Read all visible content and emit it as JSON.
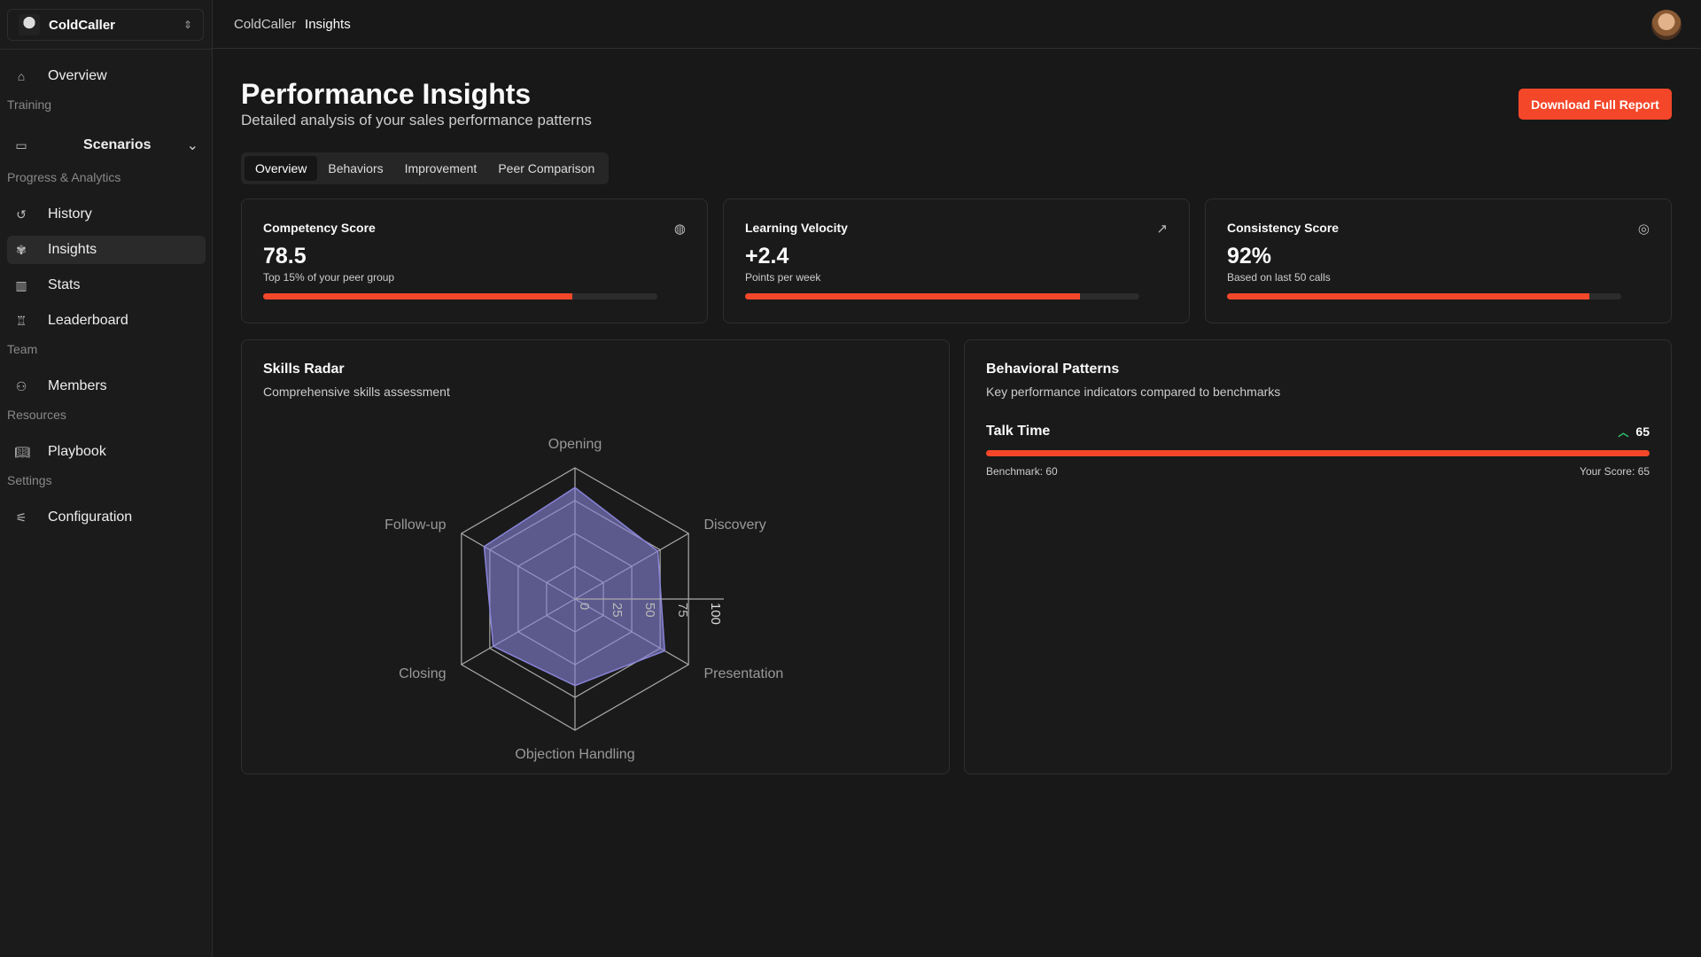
{
  "app": {
    "name": "ColdCaller"
  },
  "breadcrumb": [
    "ColdCaller",
    "Insights"
  ],
  "sidebar": {
    "overview": "Overview",
    "sections": {
      "training": "Training",
      "progress": "Progress & Analytics",
      "team": "Team",
      "resources": "Resources",
      "settings": "Settings"
    },
    "scenarios": "Scenarios",
    "history": "History",
    "insights": "Insights",
    "stats": "Stats",
    "leaderboard": "Leaderboard",
    "members": "Members",
    "playbook": "Playbook",
    "configuration": "Configuration"
  },
  "page": {
    "title": "Performance Insights",
    "subtitle": "Detailed analysis of your sales performance patterns",
    "download": "Download Full Report"
  },
  "tabs": [
    "Overview",
    "Behaviors",
    "Improvement",
    "Peer Comparison"
  ],
  "kpis": [
    {
      "title": "Competency Score",
      "value": "78.5",
      "sub": "Top 15% of your peer group",
      "progress": 78.5,
      "icon": "brain-icon"
    },
    {
      "title": "Learning Velocity",
      "value": "+2.4",
      "sub": "Points per week",
      "progress": 85,
      "icon": "trending-up-icon"
    },
    {
      "title": "Consistency Score",
      "value": "92%",
      "sub": "Based on last 50 calls",
      "progress": 92,
      "icon": "target-icon"
    }
  ],
  "radar": {
    "title": "Skills Radar",
    "subtitle": "Comprehensive skills assessment"
  },
  "behavior": {
    "title": "Behavioral Patterns",
    "subtitle": "Key performance indicators compared to benchmarks",
    "items": [
      {
        "name": "Talk Time",
        "score": "65",
        "benchmark": "Benchmark: 60",
        "your_score": "Your Score: 65",
        "progress": 100
      }
    ]
  },
  "colors": {
    "accent": "#f4472a",
    "radar_fill": "#8884d8",
    "up": "#2ecc71"
  },
  "chart_data": {
    "type": "radar",
    "categories": [
      "Opening",
      "Discovery",
      "Presentation",
      "Objection Handling",
      "Closing",
      "Follow-up"
    ],
    "values": [
      85,
      73,
      79,
      66,
      72,
      80
    ],
    "ticks": [
      "0",
      "25",
      "50",
      "75",
      "100"
    ],
    "range": [
      0,
      100
    ]
  }
}
